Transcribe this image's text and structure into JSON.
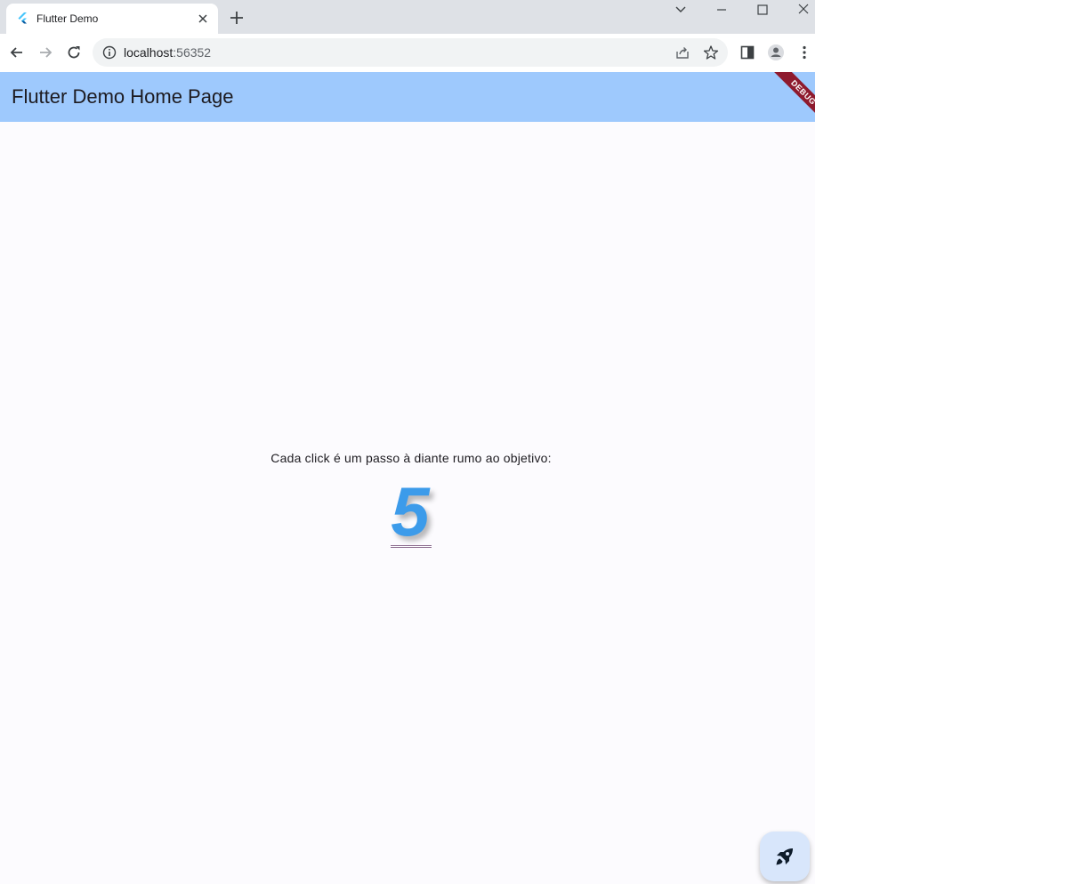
{
  "browser": {
    "tab_title": "Flutter Demo",
    "url_host": "localhost",
    "url_port": ":56352",
    "icons": {
      "favicon": "flutter-logo-icon",
      "tab_close": "close-icon",
      "new_tab": "plus-icon",
      "tab_search": "chevron-down-icon",
      "minimize": "minimize-icon",
      "maximize": "maximize-icon",
      "close_window": "close-icon",
      "back": "back-arrow-icon",
      "forward": "forward-arrow-icon",
      "reload": "reload-icon",
      "site_info": "info-icon",
      "share": "share-icon",
      "bookmark": "star-icon",
      "side_panel": "side-panel-icon",
      "profile": "profile-icon",
      "menu": "kebab-menu-icon"
    }
  },
  "app": {
    "title": "Flutter Demo Home Page",
    "debug_banner": "DEBUG",
    "caption": "Cada click é um passo à diante rumo ao objetivo:",
    "counter": "5",
    "fab_icon": "rocket-icon",
    "colors": {
      "appbar": "#9ec9fd",
      "counter": "#3c9bea",
      "fab": "#d8e6fb",
      "debug": "#8e1a2e"
    }
  }
}
